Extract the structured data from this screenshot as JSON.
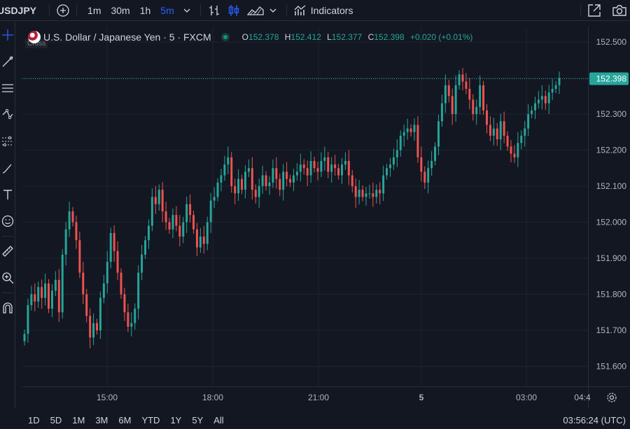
{
  "toolbar": {
    "symbol": "USDJPY",
    "intervals": [
      "1m",
      "30m",
      "1h",
      "5m"
    ],
    "active_interval": "5m",
    "indicators_label": "Indicators"
  },
  "legend": {
    "title": "U.S. Dollar / Japanese Yen · 5 · FXCM",
    "open_label": "O",
    "open": "152.378",
    "high_label": "H",
    "high": "152.412",
    "low_label": "L",
    "low": "152.377",
    "close_label": "C",
    "close": "152.398",
    "change": "+0.020 (+0.01%)",
    "cross_tag": "Cross"
  },
  "price_axis": {
    "ticks": [
      "152.500",
      "152.400",
      "152.300",
      "152.200",
      "152.100",
      "152.000",
      "151.900",
      "151.800",
      "151.700",
      "151.600"
    ],
    "last_price": "152.398"
  },
  "time_axis": {
    "ticks": [
      "15:00",
      "18:00",
      "21:00",
      "5",
      "03:00",
      "04:4"
    ]
  },
  "bottombar": {
    "ranges": [
      "1D",
      "5D",
      "1M",
      "3M",
      "6M",
      "YTD",
      "1Y",
      "5Y",
      "All"
    ],
    "clock": "03:56:24 (UTC)"
  },
  "colors": {
    "background": "#131722",
    "up": "#26a69a",
    "down": "#ef5350",
    "accent": "#2962ff",
    "last_price_tag": "#26a69a"
  },
  "chart_data": {
    "type": "candlestick",
    "title": "U.S. Dollar / Japanese Yen · 5 · FXCM",
    "ylim": [
      151.56,
      152.55
    ],
    "x_labels": [
      "15:00",
      "18:00",
      "21:00",
      "5",
      "03:00",
      "04:4"
    ],
    "y_ticks": [
      152.5,
      152.4,
      152.3,
      152.2,
      152.1,
      152.0,
      151.9,
      151.8,
      151.7,
      151.6
    ],
    "last_price": 152.398,
    "closes": [
      151.69,
      151.77,
      151.8,
      151.78,
      151.82,
      151.79,
      151.83,
      151.76,
      151.81,
      151.84,
      151.75,
      151.91,
      151.98,
      152.03,
      152.0,
      151.95,
      151.86,
      151.8,
      151.74,
      151.68,
      151.72,
      151.7,
      151.79,
      151.83,
      151.89,
      151.97,
      151.92,
      151.86,
      151.8,
      151.75,
      151.71,
      151.72,
      151.76,
      151.86,
      151.91,
      151.95,
      151.99,
      152.07,
      152.05,
      152.09,
      152.03,
      152.0,
      151.98,
      152.02,
      151.99,
      151.96,
      152.0,
      152.05,
      152.02,
      151.98,
      151.93,
      151.96,
      151.94,
      152.0,
      152.06,
      152.07,
      152.11,
      152.13,
      152.16,
      152.18,
      152.1,
      152.08,
      152.12,
      152.09,
      152.14,
      152.15,
      152.09,
      152.07,
      152.1,
      152.13,
      152.1,
      152.11,
      152.15,
      152.12,
      152.09,
      152.14,
      152.12,
      152.11,
      152.13,
      152.14,
      152.16,
      152.15,
      152.13,
      152.17,
      152.15,
      152.14,
      152.17,
      152.18,
      152.14,
      152.16,
      152.15,
      152.13,
      152.16,
      152.17,
      152.13,
      152.1,
      152.07,
      152.09,
      152.07,
      152.08,
      152.08,
      152.07,
      152.09,
      152.08,
      152.13,
      152.15,
      152.16,
      152.18,
      152.2,
      152.24,
      152.25,
      152.26,
      152.25,
      152.27,
      152.18,
      152.14,
      152.11,
      152.15,
      152.17,
      152.21,
      152.28,
      152.33,
      152.38,
      152.35,
      152.3,
      152.38,
      152.41,
      152.39,
      152.37,
      152.34,
      152.3,
      152.32,
      152.38,
      152.31,
      152.27,
      152.24,
      152.26,
      152.23,
      152.28,
      152.24,
      152.21,
      152.19,
      152.18,
      152.22,
      152.24,
      152.26,
      152.3,
      152.31,
      152.33,
      152.34,
      152.35,
      152.33,
      152.36,
      152.37,
      152.38,
      152.4
    ]
  }
}
